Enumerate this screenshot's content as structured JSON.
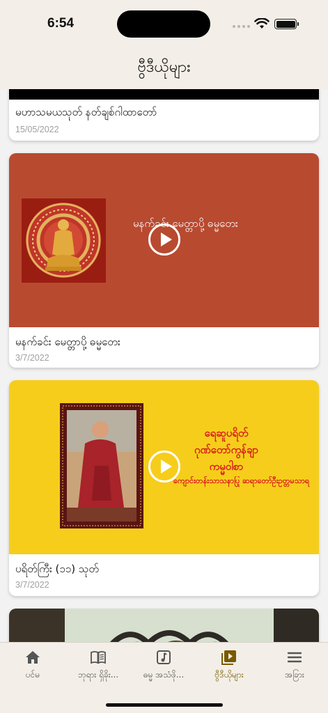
{
  "status": {
    "time": "6:54"
  },
  "header": {
    "title": "ဗွီဒီယိုများ"
  },
  "cards": [
    {
      "title": "မဟာသမယသုတ် နတ်ချစ်ဂါထာတော်",
      "date": "15/05/2022"
    },
    {
      "title": "မနက်ခင်း မေတ္တာပို့ ဓမ္မတေး",
      "date": "3/7/2022",
      "thumb_text": "မနက်ခင်း မေတ္တာပို့ ဓမ္မတေး"
    },
    {
      "title": "ပရိတ်ကြီး (၁၁) သုတ်",
      "date": "3/7/2022",
      "thumb_lines": [
        "ရေဆူပရိတ်",
        "ဂုဏ်တော်ကွန်ချာ",
        "ကမ္မဝါစာ",
        "ကျောင်းတန်းသာသနာပြု ဆရာတော်ဦးဥတ္တမသာရ"
      ]
    }
  ],
  "tabs": [
    {
      "label": "ပင်မ",
      "icon": "home-icon"
    },
    {
      "label": "ဘုရား ရှိခိုး...",
      "icon": "book-icon"
    },
    {
      "label": "ဓမ္မ အသံဖို...",
      "icon": "music-note-icon"
    },
    {
      "label": "ဗွီဒီယိုများ",
      "icon": "video-icon",
      "active": true
    },
    {
      "label": "အခြား",
      "icon": "menu-icon"
    }
  ],
  "colors": {
    "accent": "#7a5a00",
    "card2_bg": "#b84a30",
    "card3_bg": "#f6cd1b",
    "header_bg": "#f3efe8"
  }
}
